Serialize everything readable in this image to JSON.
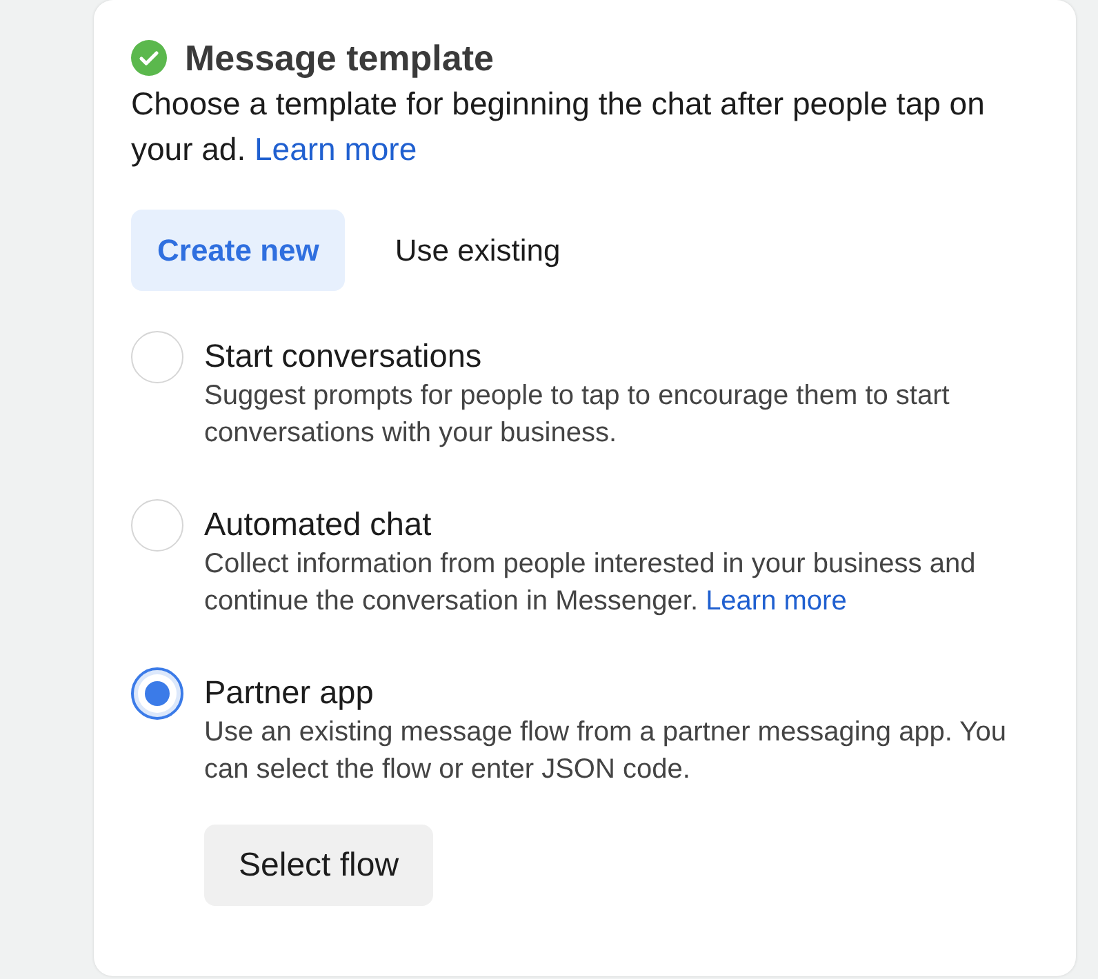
{
  "section": {
    "title": "Message template",
    "completed": true,
    "description": "Choose a template for beginning the chat after people tap on your ad.",
    "link": "Learn more"
  },
  "tabs": [
    {
      "label": "Create new",
      "selected": true
    },
    {
      "label": "Use existing",
      "selected": false
    }
  ],
  "options": [
    {
      "title": "Start conversations",
      "description": "Suggest prompts for people to tap to encourage them to start conversations with your business.",
      "selected": false
    },
    {
      "title": "Automated chat",
      "description": "Collect information from people interested in your business and continue the conversation in Messenger.",
      "link": "Learn more",
      "selected": false
    },
    {
      "title": "Partner app",
      "description": "Use an existing message flow from a partner messaging app. You can select the flow or enter JSON code.",
      "selected": true,
      "action": "Select flow"
    }
  ]
}
